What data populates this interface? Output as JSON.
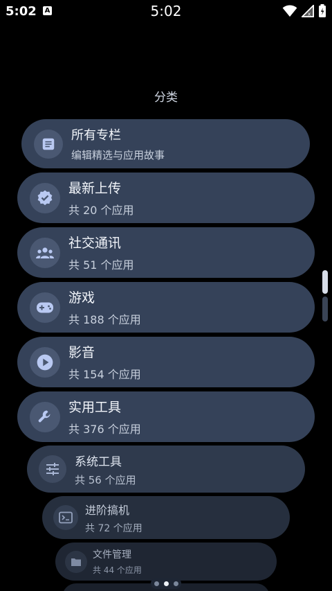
{
  "status_bar": {
    "time_left": "5:02",
    "notification_icon_letter": "A",
    "time_center": "5:02"
  },
  "page": {
    "title": "分类"
  },
  "categories": [
    {
      "title": "所有专栏",
      "subtitle": "编辑精选与应用故事",
      "icon": "article-icon"
    },
    {
      "title": "最新上传",
      "subtitle": "共 20 个应用",
      "icon": "verified-badge-icon"
    },
    {
      "title": "社交通讯",
      "subtitle": "共 51 个应用",
      "icon": "group-icon"
    },
    {
      "title": "游戏",
      "subtitle": "共 188 个应用",
      "icon": "gamepad-icon"
    },
    {
      "title": "影音",
      "subtitle": "共 154 个应用",
      "icon": "play-circle-icon"
    },
    {
      "title": "实用工具",
      "subtitle": "共 376 个应用",
      "icon": "wrench-icon"
    },
    {
      "title": "系统工具",
      "subtitle": "共 56 个应用",
      "icon": "tune-sliders-icon"
    },
    {
      "title": "进阶搞机",
      "subtitle": "共 72 个应用",
      "icon": "terminal-icon"
    },
    {
      "title": "文件管理",
      "subtitle": "共 44 个应用",
      "icon": "folder-icon"
    }
  ],
  "colors": {
    "background": "#000000",
    "card": "#354259",
    "icon_circle": "#4a5872",
    "icon_accent": "#b9c9f2"
  }
}
